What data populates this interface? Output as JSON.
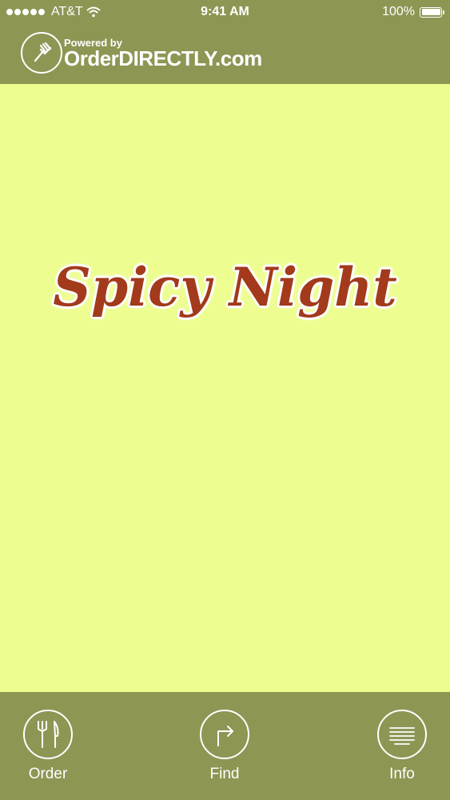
{
  "status_bar": {
    "carrier": "AT&T",
    "time": "9:41 AM",
    "battery": "100%",
    "battery_level": 1.0
  },
  "header": {
    "powered_by": "Powered by",
    "brand": "OrderDIRECTLY.com",
    "logo_icon": "fork-icon"
  },
  "main": {
    "restaurant_name": "Spicy Night"
  },
  "tab_bar": {
    "items": [
      {
        "label": "Order",
        "icon": "cutlery-icon"
      },
      {
        "label": "Find",
        "icon": "directions-icon"
      },
      {
        "label": "Info",
        "icon": "menu-lines-icon"
      }
    ]
  },
  "colors": {
    "bar": "#8e9654",
    "background": "#eefd8f",
    "title": "#a23a1b"
  }
}
